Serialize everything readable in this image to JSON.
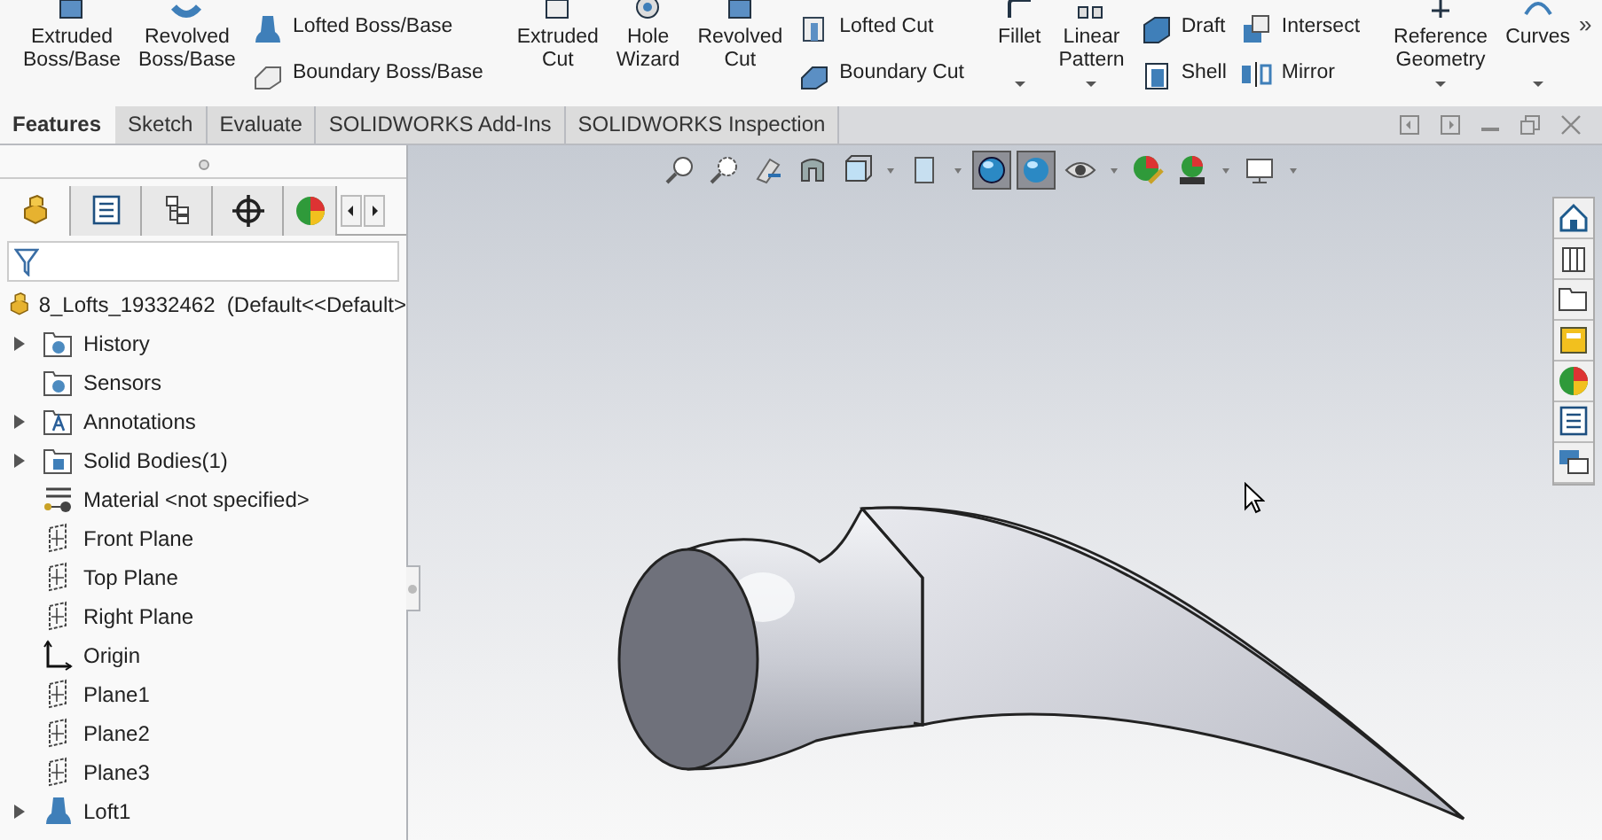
{
  "ribbon": [
    {
      "kind": "large",
      "lines": [
        "Extruded",
        "Boss/Base"
      ],
      "dropdown": false
    },
    {
      "kind": "large",
      "lines": [
        "Revolved",
        "Boss/Base"
      ],
      "dropdown": false
    },
    {
      "kind": "stack",
      "entries": [
        "Lofted Boss/Base",
        "Boundary Boss/Base"
      ]
    },
    {
      "kind": "divider"
    },
    {
      "kind": "large",
      "lines": [
        "Extruded",
        "Cut"
      ],
      "dropdown": false
    },
    {
      "kind": "large",
      "lines": [
        "Hole",
        "Wizard"
      ],
      "dropdown": false
    },
    {
      "kind": "large",
      "lines": [
        "Revolved",
        "Cut"
      ],
      "dropdown": false
    },
    {
      "kind": "stack",
      "entries": [
        "Lofted Cut",
        "Boundary Cut"
      ]
    },
    {
      "kind": "divider"
    },
    {
      "kind": "large",
      "lines": [
        "Fillet"
      ],
      "dropdown": true
    },
    {
      "kind": "large",
      "lines": [
        "Linear",
        "Pattern"
      ],
      "dropdown": true
    },
    {
      "kind": "stack",
      "entries": [
        "Draft",
        "Shell"
      ]
    },
    {
      "kind": "stack",
      "entries": [
        "Intersect",
        "Mirror"
      ]
    },
    {
      "kind": "divider"
    },
    {
      "kind": "large",
      "lines": [
        "Reference",
        "Geometry"
      ],
      "dropdown": true
    },
    {
      "kind": "large",
      "lines": [
        "Curves"
      ],
      "dropdown": true
    },
    {
      "kind": "more",
      "label": "»"
    }
  ],
  "tabs": [
    {
      "label": "Features",
      "selected": true
    },
    {
      "label": "Sketch",
      "selected": false
    },
    {
      "label": "Evaluate",
      "selected": false
    },
    {
      "label": "SOLIDWORKS Add-Ins",
      "selected": false
    },
    {
      "label": "SOLIDWORKS Inspection",
      "selected": false
    }
  ],
  "panel_tabs": [
    {
      "selected": true
    },
    {
      "selected": false
    },
    {
      "selected": false
    },
    {
      "selected": false
    },
    {
      "selected": false
    }
  ],
  "tree": {
    "root": "8_Lofts_19332462  (Default<<Default>",
    "items": [
      {
        "label": "History",
        "kind": "folder",
        "expandable": true
      },
      {
        "label": "Sensors",
        "kind": "folder",
        "expandable": false
      },
      {
        "label": "Annotations",
        "kind": "annotations",
        "expandable": true
      },
      {
        "label": "Solid Bodies(1)",
        "kind": "bodies",
        "expandable": true
      },
      {
        "label": "Material <not specified>",
        "kind": "material",
        "expandable": false
      },
      {
        "label": "Front Plane",
        "kind": "plane",
        "expandable": false
      },
      {
        "label": "Top Plane",
        "kind": "plane",
        "expandable": false
      },
      {
        "label": "Right Plane",
        "kind": "plane",
        "expandable": false
      },
      {
        "label": "Origin",
        "kind": "origin",
        "expandable": false
      },
      {
        "label": "Plane1",
        "kind": "plane",
        "expandable": false
      },
      {
        "label": "Plane2",
        "kind": "plane",
        "expandable": false
      },
      {
        "label": "Plane3",
        "kind": "plane",
        "expandable": false
      },
      {
        "label": "Loft1",
        "kind": "loft",
        "expandable": true
      }
    ]
  },
  "view_toolbar": [
    {
      "selected": false,
      "dropdown": false
    },
    {
      "selected": false,
      "dropdown": false
    },
    {
      "selected": false,
      "dropdown": false
    },
    {
      "selected": false,
      "dropdown": false
    },
    {
      "selected": false,
      "dropdown": true
    },
    {
      "selected": false,
      "dropdown": true
    },
    {
      "selected": true,
      "dropdown": false
    },
    {
      "selected": true,
      "dropdown": false
    },
    {
      "selected": false,
      "dropdown": true
    },
    {
      "selected": false,
      "dropdown": false
    },
    {
      "selected": false,
      "dropdown": true
    },
    {
      "selected": false,
      "dropdown": true
    }
  ]
}
